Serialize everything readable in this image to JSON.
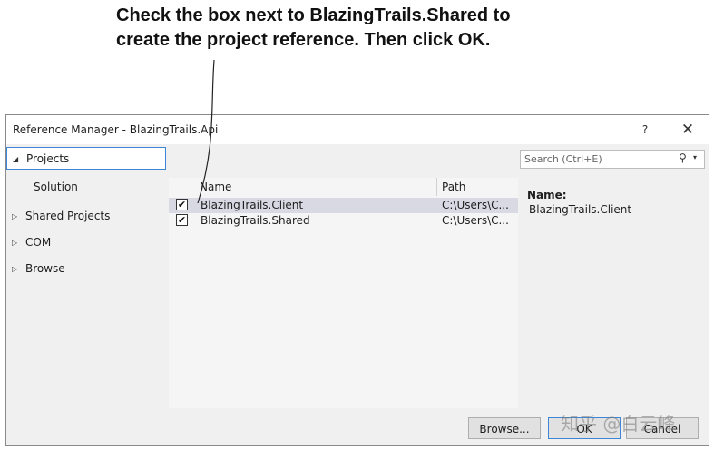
{
  "annotation": {
    "line1": "Check the box next to BlazingTrails.Shared to",
    "line2": "create the project reference. Then click OK."
  },
  "dialog": {
    "title": "Reference Manager - BlazingTrails.Api",
    "help_label": "?",
    "close_label": "✕"
  },
  "nav": {
    "items": [
      {
        "label": "Projects",
        "arrow": "◢"
      },
      {
        "label": "Solution"
      },
      {
        "label": "Shared Projects",
        "arrow": "▷"
      },
      {
        "label": "COM",
        "arrow": "▷"
      },
      {
        "label": "Browse",
        "arrow": "▷"
      }
    ]
  },
  "list": {
    "columns": [
      "Name",
      "Path"
    ],
    "rows": [
      {
        "name": "BlazingTrails.Client",
        "path": "C:\\Users\\C...",
        "check": "✔"
      },
      {
        "name": "BlazingTrails.Shared",
        "path": "C:\\Users\\C...",
        "check": "✔"
      }
    ]
  },
  "search": {
    "placeholder": "Search (Ctrl+E)",
    "icon": "⚲",
    "dropdown": "▾"
  },
  "details": {
    "label": "Name:",
    "value": "BlazingTrails.Client"
  },
  "buttons": {
    "browse": "Browse...",
    "ok": "OK",
    "cancel": "Cancel"
  },
  "watermark": "知乎 @白云峰"
}
